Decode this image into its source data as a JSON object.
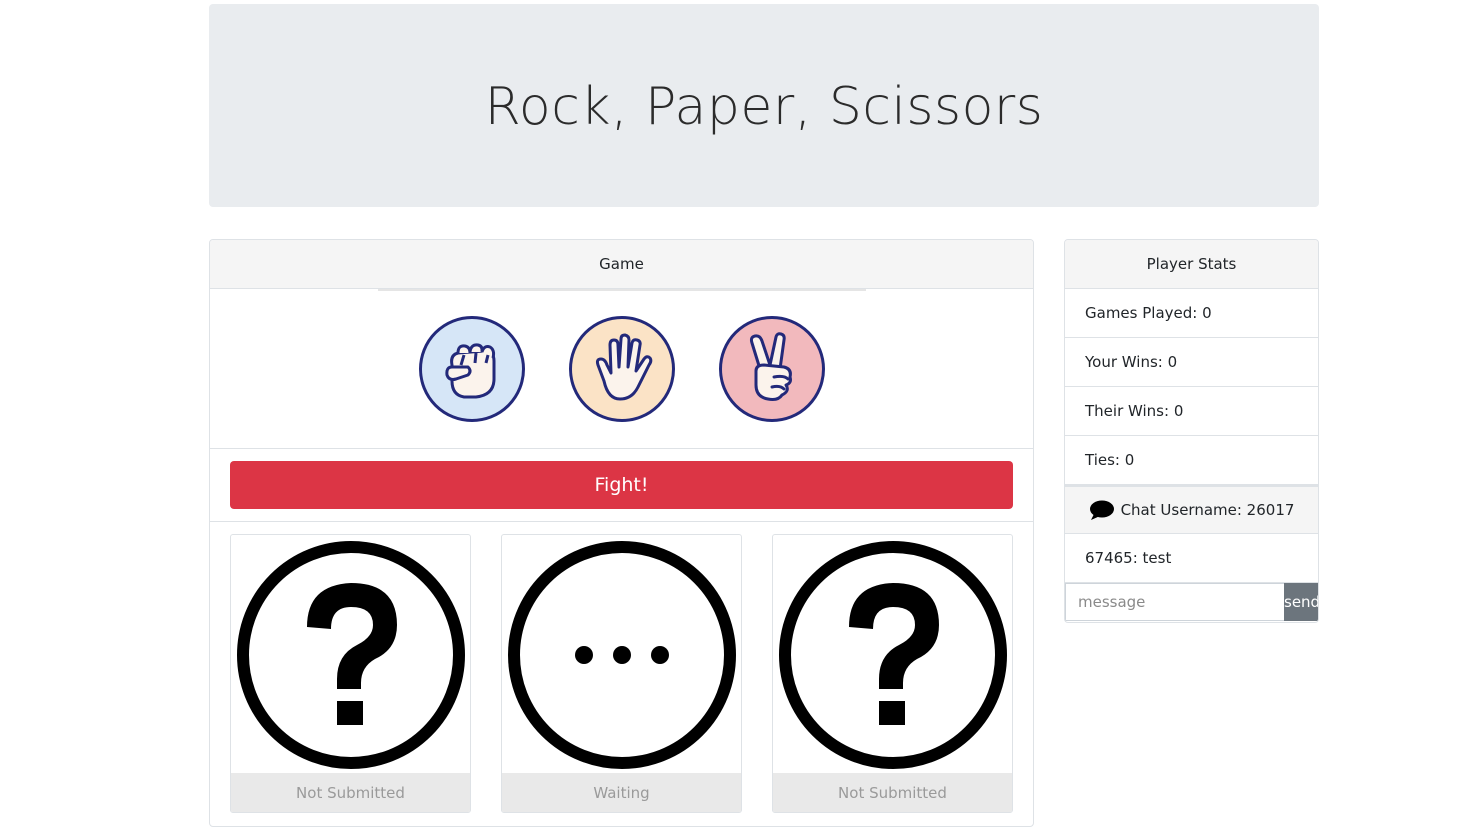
{
  "header": {
    "title": "Rock, Paper, Scissors"
  },
  "game": {
    "header": "Game",
    "choices": [
      {
        "name": "rock",
        "icon": "rock-hand-icon",
        "bg": "#d6e6f7"
      },
      {
        "name": "paper",
        "icon": "paper-hand-icon",
        "bg": "#fbe3c6"
      },
      {
        "name": "scissors",
        "icon": "scissors-hand-icon",
        "bg": "#f2b9bd"
      }
    ],
    "fight_label": "Fight!",
    "results": [
      {
        "icon": "question-mark-icon",
        "status": "Not Submitted"
      },
      {
        "icon": "ellipsis-icon",
        "status": "Waiting"
      },
      {
        "icon": "question-mark-icon",
        "status": "Not Submitted"
      }
    ]
  },
  "stats": {
    "header": "Player Stats",
    "games_played": "Games Played: 0",
    "your_wins": "Your Wins: 0",
    "their_wins": "Their Wins: 0",
    "ties": "Ties: 0"
  },
  "chat": {
    "header": "Chat Username: 26017",
    "messages": [
      "67465: test"
    ],
    "input_placeholder": "message",
    "send_label": "send"
  },
  "colors": {
    "danger": "#dc3545",
    "secondary": "#6c757d",
    "jumbotron": "#e9ecef",
    "icon_border": "#23297a"
  }
}
